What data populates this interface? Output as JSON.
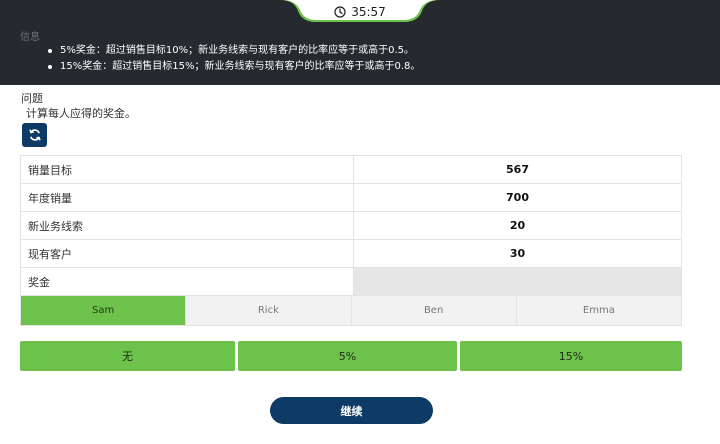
{
  "timer": {
    "value": "35:57"
  },
  "info": {
    "label": "信息",
    "items": [
      "5%奖金：超过销售目标10%；新业务线索与现有客户的比率应等于或高于0.5。",
      "15%奖金：超过销售目标15%；新业务线索与现有客户的比率应等于或高于0.8。"
    ]
  },
  "question": {
    "label": "问题",
    "text": "计算每人应得的奖金。"
  },
  "table": {
    "rows": [
      {
        "label": "销量目标",
        "value": "567"
      },
      {
        "label": "年度销量",
        "value": "700"
      },
      {
        "label": "新业务线索",
        "value": "20"
      },
      {
        "label": "现有客户",
        "value": "30"
      },
      {
        "label": "奖金",
        "value": ""
      }
    ]
  },
  "tabs": [
    "Sam",
    "Rick",
    "Ben",
    "Emma"
  ],
  "active_tab": "Sam",
  "options": [
    "无",
    "5%",
    "15%"
  ],
  "continue_label": "继续",
  "colors": {
    "header_bg": "#262a2e",
    "accent_green": "#6cc24a",
    "navy": "#0e3a66"
  }
}
